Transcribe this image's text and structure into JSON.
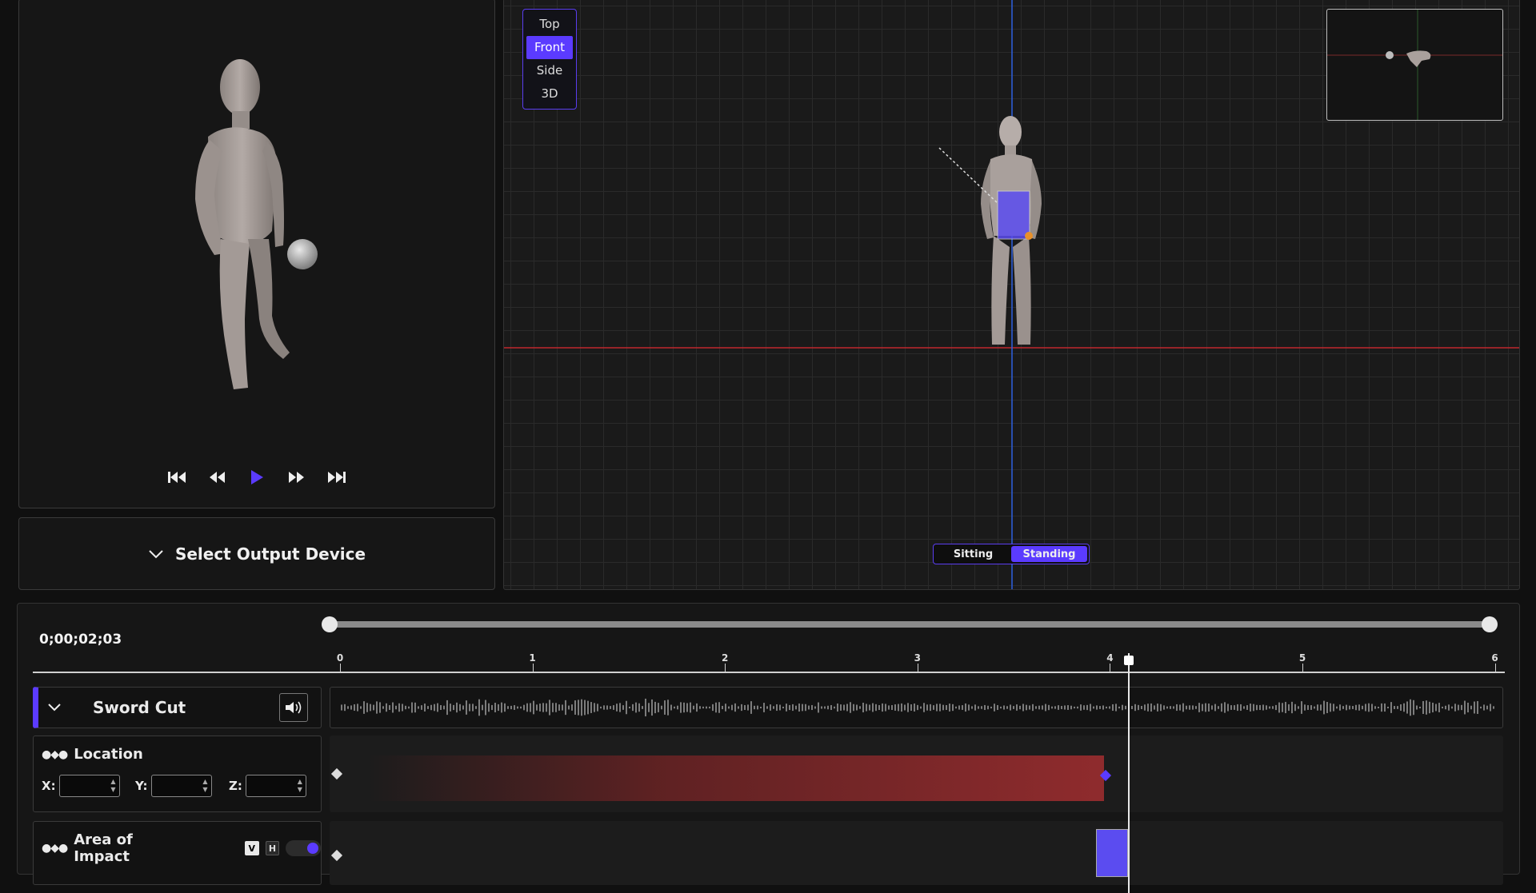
{
  "preview": {
    "transport": [
      "skip-to-start-icon",
      "rewind-icon",
      "play-icon",
      "fast-forward-icon",
      "skip-to-end-icon"
    ]
  },
  "output_device": {
    "label": "Select Output Device"
  },
  "viewport": {
    "views": [
      "Top",
      "Front",
      "Side",
      "3D"
    ],
    "active_view": "Front",
    "postures": [
      "Sitting",
      "Standing"
    ],
    "active_posture": "Standing"
  },
  "timeline": {
    "timecode": "0;00;02;03",
    "ruler_labels": [
      "0",
      "1",
      "2",
      "3",
      "4",
      "5",
      "6"
    ],
    "playhead_seconds": 4.0,
    "range": [
      0,
      6
    ],
    "tracks": {
      "sword": {
        "title": "Sword Cut"
      },
      "location": {
        "title": "Location",
        "x_label": "X:",
        "y_label": "Y:",
        "z_label": "Z:"
      },
      "impact": {
        "title": "Area of Impact",
        "v_label": "V",
        "h_label": "H",
        "toggle_on": true
      }
    }
  },
  "colors": {
    "accent": "#5b3bff",
    "location_bar": "#8f2b2d",
    "axis_red": "#c0282d",
    "axis_blue": "#2d5fe0"
  }
}
